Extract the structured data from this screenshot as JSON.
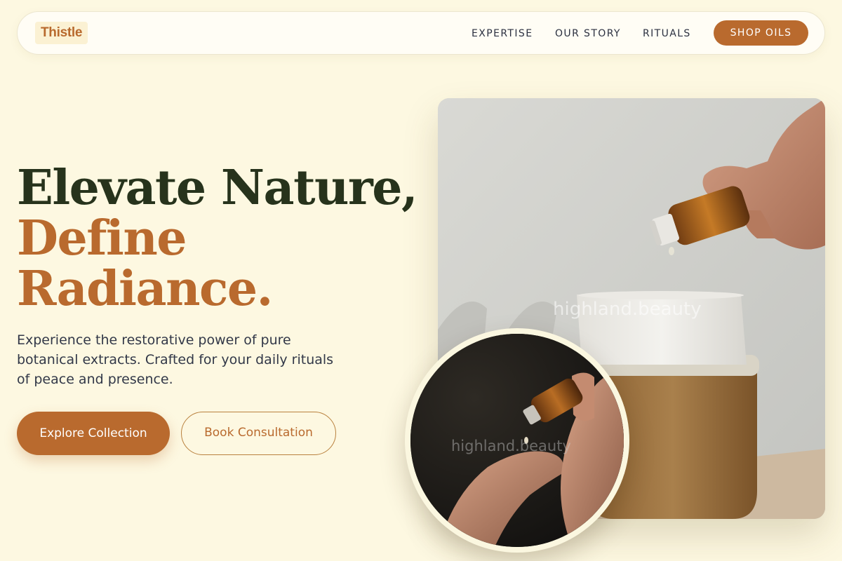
{
  "brand": {
    "name": "Thistle"
  },
  "nav": {
    "links": [
      {
        "label": "EXPERTISE"
      },
      {
        "label": "OUR STORY"
      },
      {
        "label": "RITUALS"
      }
    ],
    "cta": "SHOP OILS"
  },
  "hero": {
    "headline": {
      "line1": "Elevate Nature,",
      "line2": "Define",
      "line3": "Radiance."
    },
    "lead": "Experience the restorative power of pure botanical extracts. Crafted for your daily rituals of peace and presence.",
    "primary_cta": "Explore Collection",
    "secondary_cta": "Book Consultation"
  },
  "images": {
    "main_watermark": "highland.beauty",
    "circle_watermark": "highland.beauty"
  },
  "colors": {
    "background": "#fdf8e1",
    "accent": "#b96a2e",
    "headline_dark": "#27331c",
    "body_text": "#323848"
  }
}
